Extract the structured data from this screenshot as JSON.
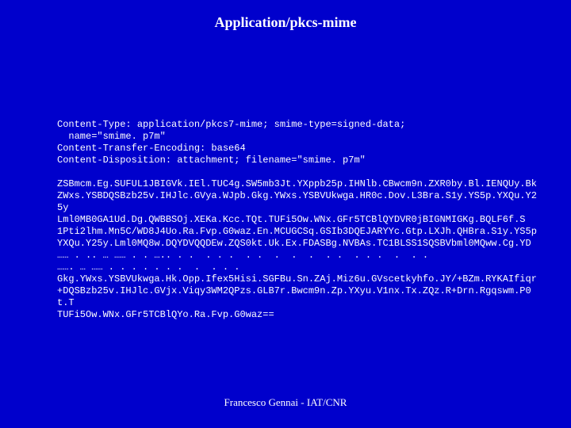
{
  "title": "Application/pkcs-mime",
  "headers": {
    "line1": "Content-Type: application/pkcs7-mime; smime-type=signed-data;",
    "line1b": "  name=\"smime. p7m\"",
    "line2": "Content-Transfer-Encoding: base64",
    "line3": "Content-Disposition: attachment; filename=\"smime. p7m\""
  },
  "body": {
    "l1": "ZSBmcm.Eg.SUFUL1JBIGVk.IEl.TUC4g.SW5mb3Jt.YXppb25p.IHNlb.CBwcm9n.ZXR0by.Bl.IENQUy.Bk",
    "l2": "ZWxs.YSBDQSBzb25v.IHJlc.GVya.WJpb.Gkg.YWxs.YSBVUkwga.HR0c.Dov.L3Bra.S1y.YS5p.YXQu.Y25y",
    "l3": "Lml0MB0GA1Ud.Dg.QWBBSOj.XEKa.Kcc.TQt.TUFi5Ow.WNx.GFr5TCBlQYDVR0jBIGNMIGKg.BQLF6f.S",
    "l4": "1Pti2lhm.Mn5C/WD8J4Uo.Ra.Fvp.G0waz.En.MCUGCSq.GSIb3DQEJARYYc.Gtp.LXJh.QHBra.S1y.YS5p",
    "l5": "YXQu.Y25y.Lml0MQ8w.DQYDVQQDEw.ZQS0kt.Uk.Ex.FDASBg.NVBAs.TC1BLSS1SQSBVbml0MQww.Cg.YD",
    "l6": "…… . .. … …… . . ….. . .  . . .  . .  .  .  .  . .  . . .  .  . .",
    "l7": "……. … …… . . . . . . .  .  . . .",
    "l8": "Gkg.YWxs.YSBVUkwga.Hk.Opp.Ifex5Hisi.SGFBu.Sn.ZAj.Miz6u.GVscetkyhfo.JY/+BZm.RYKAIfiqr",
    "l9": "+DQSBzb25v.IHJlc.GVjx.Viqy3WM2QPzs.GLB7r.Bwcm9n.Zp.YXyu.V1nx.Tx.ZQz.R+Drn.Rgqswm.P0t.T",
    "l10": "TUFi5Ow.WNx.GFr5TCBlQYo.Ra.Fvp.G0waz=="
  },
  "footer": "Francesco Gennai - IAT/CNR"
}
